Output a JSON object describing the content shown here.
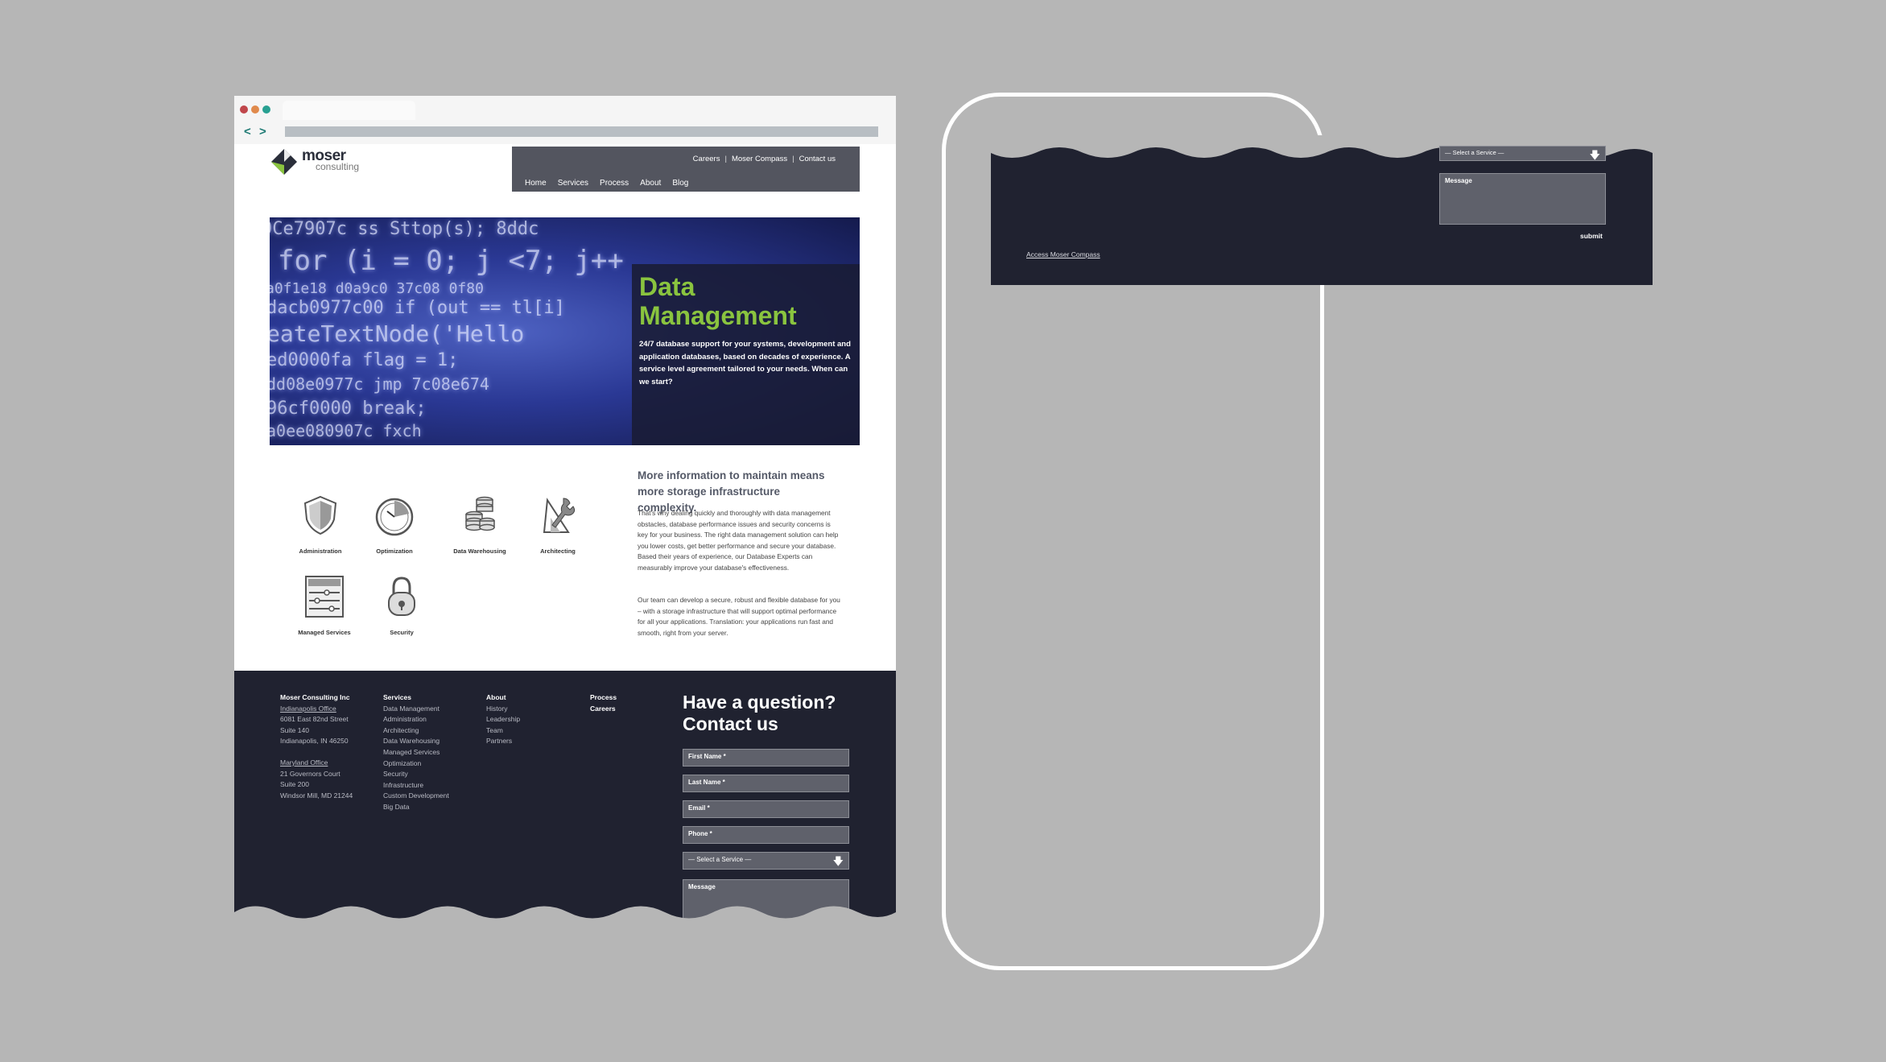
{
  "browser": {
    "back": "<",
    "forward": ">"
  },
  "logo": {
    "word": "moser",
    "sub": "consulting"
  },
  "utility_nav": [
    "Careers",
    "Moser Compass",
    "Contact us"
  ],
  "main_nav": [
    "Home",
    "Services",
    "Process",
    "About",
    "Blog"
  ],
  "hero": {
    "title": "Data Management",
    "text": "24/7 database support for your systems, development and application databases, based on decades of experience. A service level agreement tailored to your needs. When can we start?"
  },
  "services": [
    {
      "label": "Administration",
      "icon": "shield-icon"
    },
    {
      "label": "Optimization",
      "icon": "gauge-icon"
    },
    {
      "label": "Data Warehousing",
      "icon": "database-icon"
    },
    {
      "label": "Architecting",
      "icon": "tools-icon"
    },
    {
      "label": "Managed Services",
      "icon": "server-rack-icon"
    },
    {
      "label": "Security",
      "icon": "padlock-icon"
    }
  ],
  "info": {
    "heading": "More information to maintain means more storage infrastructure complexity.",
    "p1": "That's why dealing quickly and thoroughly with data management obstacles, database performance issues and security concerns is key for your business. The right data management solution can help you lower costs, get better performance and secure your database. Based their years of experience, our Database Experts can measurably improve your database's effectiveness.",
    "p2": "Our team can develop a secure, robust and flexible database for you – with a storage infrastructure that will support optimal performance for all your applications. Translation: your applications run fast and smooth, right from your server."
  },
  "footer": {
    "company": "Moser Consulting Inc",
    "office1": {
      "name": "Indianapolis Office",
      "lines": [
        "6081 East 82nd Street",
        "Suite 140",
        "Indianapolis, IN 46250"
      ]
    },
    "office2": {
      "name": "Maryland Office",
      "lines": [
        "21 Governors Court",
        "Suite 200",
        "Windsor Mill, MD 21244"
      ]
    },
    "services_head": "Services",
    "services": [
      "Data Management",
      "Administration",
      "Architecting",
      "Data Warehousing",
      "Managed Services",
      "Optimization",
      "Security",
      "Infrastructure",
      "Custom Development",
      "Big Data"
    ],
    "about_head": "About",
    "about": [
      "History",
      "Leadership",
      "Team",
      "Partners"
    ],
    "process": "Process",
    "careers": "Careers",
    "cta": "Have a question? Contact us",
    "fields": [
      "First Name *",
      "Last Name *",
      "Email *",
      "Phone *"
    ],
    "select": "— Select a Service —",
    "message": "Message"
  },
  "panel": {
    "select": "— Select a Service —",
    "message": "Message",
    "submit": "submit",
    "access": "Access Moser Compass"
  },
  "colors": {
    "accent": "#8ac43f",
    "footer": "#202230",
    "nav": "#53555f",
    "background": "#b6b6b6"
  }
}
